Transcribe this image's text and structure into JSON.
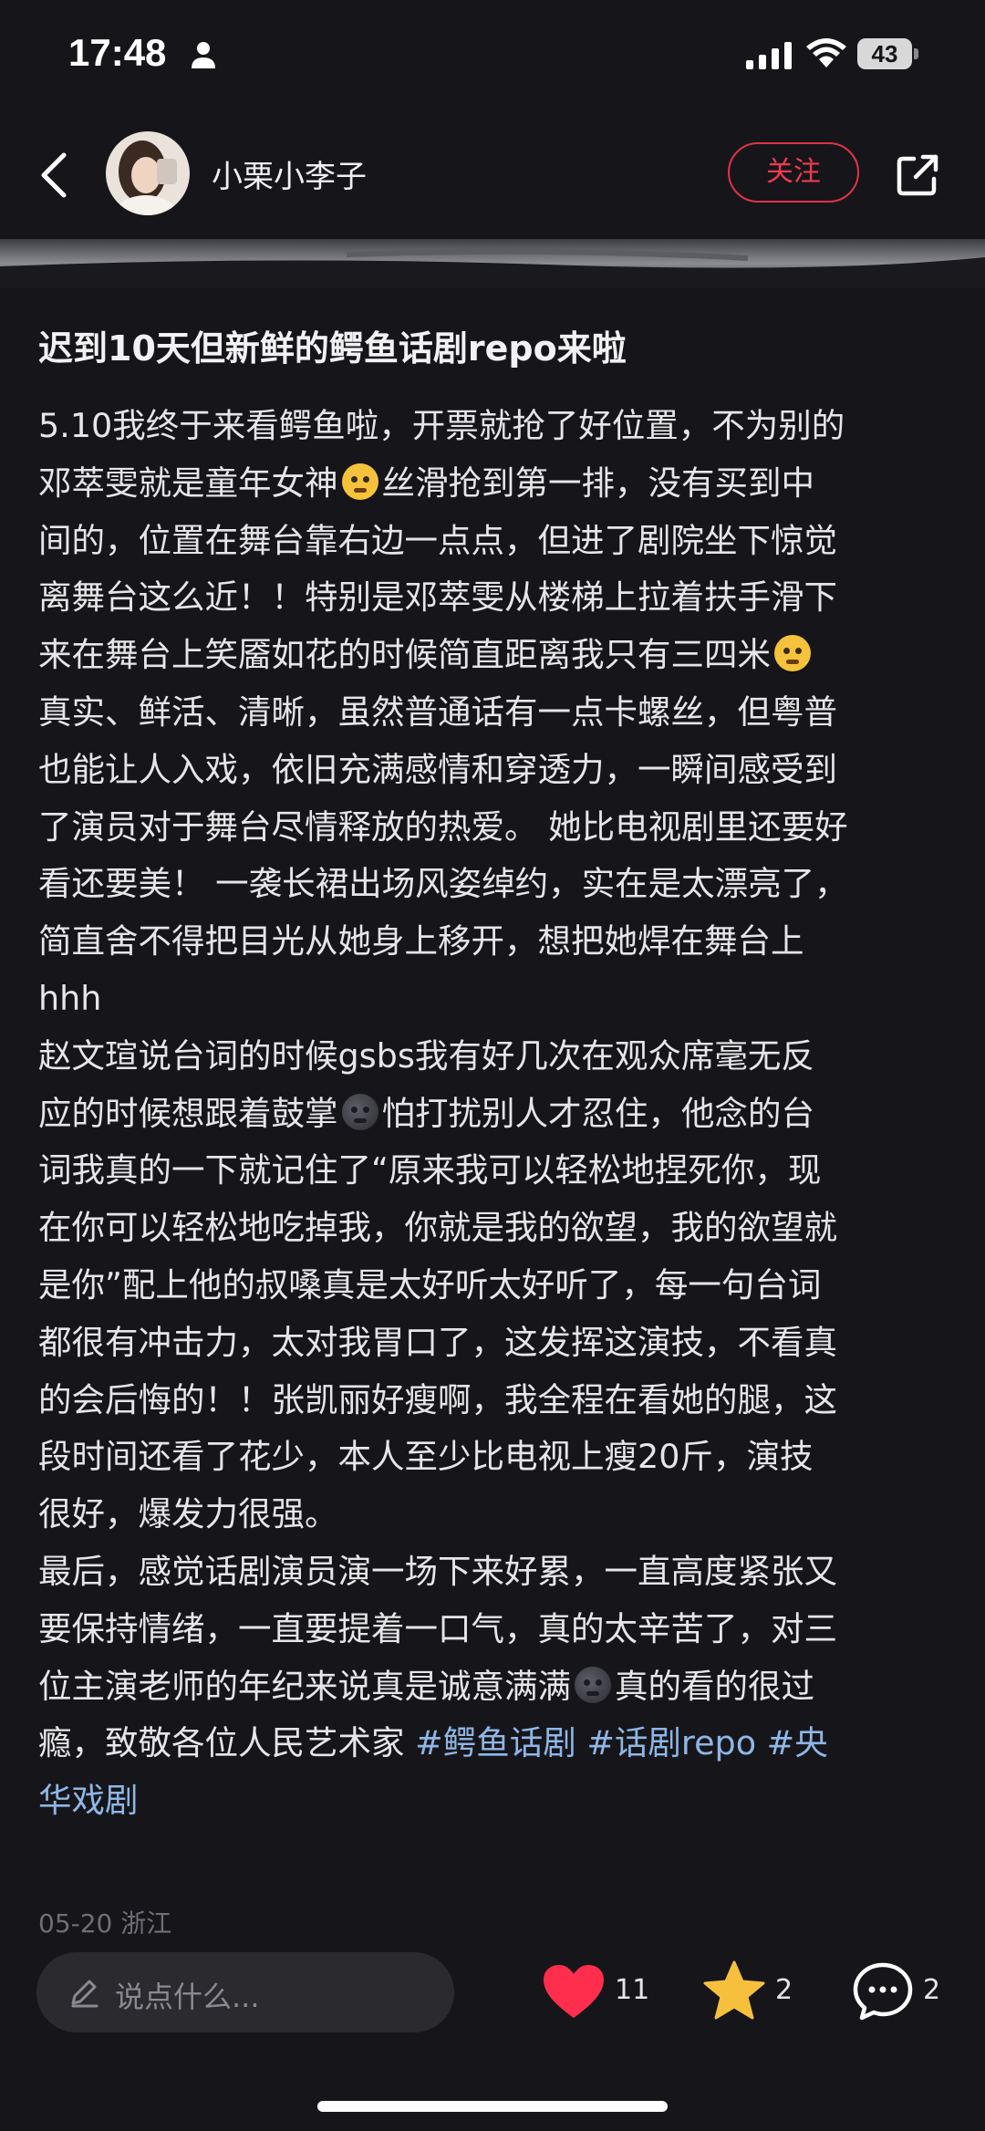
{
  "status_bar": {
    "time": "17:48",
    "battery": "43",
    "icons": [
      "person-icon",
      "signal-icon",
      "wifi-icon",
      "battery-icon"
    ]
  },
  "header": {
    "author_name": "小栗小李子",
    "follow_label": "关注",
    "icons": [
      "back-icon",
      "avatar",
      "share-icon"
    ]
  },
  "post": {
    "title": "迟到10天但新鲜的鳄鱼话剧repo来啦",
    "lines": [
      {
        "parts": [
          {
            "t": "text",
            "v": "5.10我终于来看鳄鱼啦，开票就抢了好位置，不为别的"
          }
        ]
      },
      {
        "parts": [
          {
            "t": "text",
            "v": "邓萃雯就是童年女神"
          },
          {
            "t": "emoji",
            "v": "loudly-crying-face-emoji"
          },
          {
            "t": "text",
            "v": "丝滑抢到第一排，没有买到中"
          }
        ]
      },
      {
        "parts": [
          {
            "t": "text",
            "v": "间的，位置在舞台靠右边一点点，但进了剧院坐下惊觉"
          }
        ]
      },
      {
        "parts": [
          {
            "t": "text",
            "v": "离舞台这么近！！特别是邓萃雯从楼梯上拉着扶手滑下"
          }
        ]
      },
      {
        "parts": [
          {
            "t": "text",
            "v": "来在舞台上笑靥如花的时候简直距离我只有三四米"
          },
          {
            "t": "emoji",
            "v": "pleading-face-emoji"
          }
        ]
      },
      {
        "parts": [
          {
            "t": "text",
            "v": "真实、鲜活、清晰，虽然普通话有一点卡螺丝，但粤普"
          }
        ]
      },
      {
        "parts": [
          {
            "t": "text",
            "v": "也能让人入戏，依旧充满感情和穿透力，一瞬间感受到"
          }
        ]
      },
      {
        "parts": [
          {
            "t": "text",
            "v": "了演员对于舞台尽情释放的热爱。 她比电视剧里还要好"
          }
        ]
      },
      {
        "parts": [
          {
            "t": "text",
            "v": "看还要美！ 一袭长裙出场风姿绰约，实在是太漂亮了，"
          }
        ]
      },
      {
        "parts": [
          {
            "t": "text",
            "v": "简直舍不得把目光从她身上移开，想把她焊在舞台上"
          }
        ]
      },
      {
        "parts": [
          {
            "t": "text",
            "v": "hhh"
          }
        ]
      },
      {
        "parts": [
          {
            "t": "text",
            "v": "赵文瑄说台词的时候gsbs我有好几次在观众席毫无反"
          }
        ]
      },
      {
        "parts": [
          {
            "t": "text",
            "v": "应的时候想跟着鼓掌"
          },
          {
            "t": "emoji",
            "v": "new-moon-face-emoji"
          },
          {
            "t": "text",
            "v": "怕打扰别人才忍住，他念的台"
          }
        ]
      },
      {
        "parts": [
          {
            "t": "text",
            "v": "词我真的一下就记住了“原来我可以轻松地捏死你，现"
          }
        ]
      },
      {
        "parts": [
          {
            "t": "text",
            "v": "在你可以轻松地吃掉我，你就是我的欲望，我的欲望就"
          }
        ]
      },
      {
        "parts": [
          {
            "t": "text",
            "v": "是你”配上他的叔嗓真是太好听太好听了，每一句台词"
          }
        ]
      },
      {
        "parts": [
          {
            "t": "text",
            "v": "都很有冲击力，太对我胃口了，这发挥这演技，不看真"
          }
        ]
      },
      {
        "parts": [
          {
            "t": "text",
            "v": "的会后悔的！！张凯丽好瘦啊，我全程在看她的腿，这"
          }
        ]
      },
      {
        "parts": [
          {
            "t": "text",
            "v": "段时间还看了花少，本人至少比电视上瘦20斤，演技"
          }
        ]
      },
      {
        "parts": [
          {
            "t": "text",
            "v": "很好，爆发力很强。"
          }
        ]
      },
      {
        "parts": [
          {
            "t": "text",
            "v": "最后，感觉话剧演员演一场下来好累，一直高度紧张又"
          }
        ]
      },
      {
        "parts": [
          {
            "t": "text",
            "v": "要保持情绪，一直要提着一口气，真的太辛苦了，对三"
          }
        ]
      },
      {
        "parts": [
          {
            "t": "text",
            "v": "位主演老师的年纪来说真是诚意满满"
          },
          {
            "t": "emoji",
            "v": "new-moon-face-emoji"
          },
          {
            "t": "text",
            "v": "真的看的很过"
          }
        ]
      },
      {
        "parts": [
          {
            "t": "text",
            "v": "瘾，致敬各位人民艺术家 "
          },
          {
            "t": "tag",
            "v": "#鳄鱼话剧"
          },
          {
            "t": "text",
            "v": "  "
          },
          {
            "t": "tag",
            "v": "#话剧repo"
          },
          {
            "t": "text",
            "v": "  "
          },
          {
            "t": "tag",
            "v": "#央"
          }
        ]
      },
      {
        "parts": [
          {
            "t": "tag",
            "v": "华戏剧"
          }
        ]
      }
    ],
    "date": "05-20 浙江"
  },
  "bottom_bar": {
    "comment_placeholder": "说点什么...",
    "like_count": "11",
    "star_count": "2",
    "comment_count": "2",
    "colors": {
      "like": "#ff2e4d",
      "star": "#f6c03d"
    }
  }
}
